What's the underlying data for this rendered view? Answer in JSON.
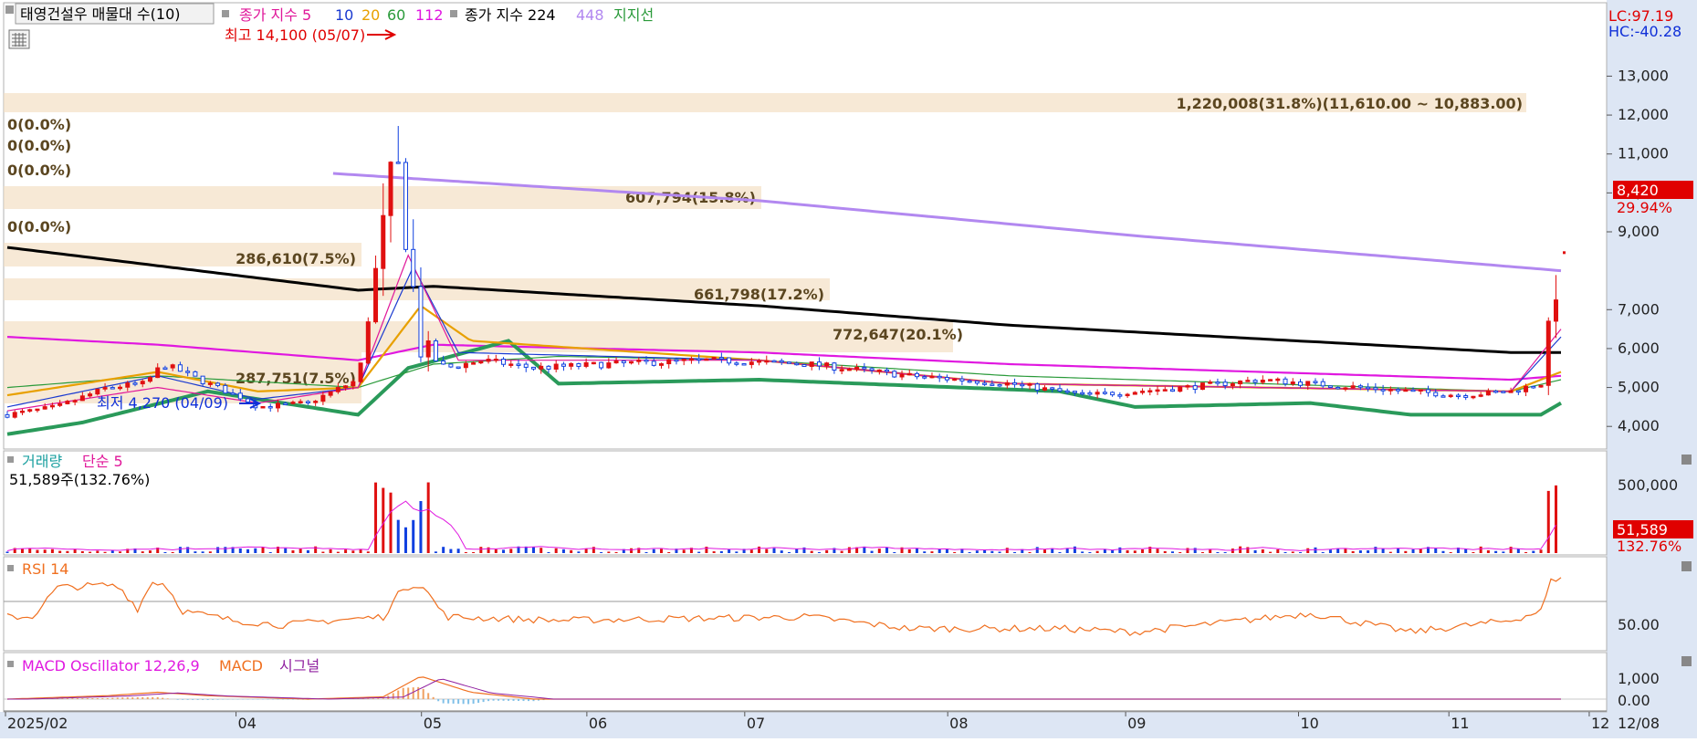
{
  "price_panel": {
    "title": "태영건설우 매물대 수(10)",
    "legend": [
      {
        "text": "종가 지수 5",
        "color": "#e0189a"
      },
      {
        "text": "10",
        "color": "#1a3ad0"
      },
      {
        "text": "20",
        "color": "#e8a000"
      },
      {
        "text": "60",
        "color": "#2a9a3a"
      },
      {
        "text": "112",
        "color": "#e018e0"
      },
      {
        "text": "종가 지수 224",
        "color": "#000000"
      },
      {
        "text": "448",
        "color": "#b288f0"
      },
      {
        "text": "지지선",
        "color": "#2a9a3a"
      }
    ],
    "high_label": "최고 14,100 (05/07)",
    "low_label": "최저 4,270 (04/09)",
    "lc": "LC:97.19",
    "hc": "HC:-40.28",
    "current_price": "8,420",
    "current_pct": "29.94%",
    "volume_profile": [
      {
        "text": "1,220,008(31.8%)(11,610.00 ~ 10,883.00)"
      },
      {
        "text": "0(0.0%)"
      },
      {
        "text": "0(0.0%)"
      },
      {
        "text": "0(0.0%)"
      },
      {
        "text": "607,794(15.8%)"
      },
      {
        "text": "0(0.0%)"
      },
      {
        "text": "286,610(7.5%)"
      },
      {
        "text": "661,798(17.2%)"
      },
      {
        "text": "772,647(20.1%)"
      },
      {
        "text": "287,751(7.5%)"
      }
    ],
    "y_ticks": [
      "13,000",
      "12,000",
      "11,000",
      "10,000",
      "9,000",
      "7,000",
      "6,000",
      "5,000",
      "4,000"
    ]
  },
  "volume_panel": {
    "legend_main": "거래량",
    "legend_ma": "단순 5",
    "value": "51,589주(132.76%)",
    "tick": "500,000",
    "badge_value": "51,589",
    "badge_pct": "132.76%"
  },
  "rsi_panel": {
    "label": "RSI 14",
    "tick": "50.00"
  },
  "macd_panel": {
    "label_osc": "MACD Oscillator 12,26,9",
    "label_macd": "MACD",
    "label_signal": "시그널",
    "ticks": [
      "1,000",
      "0.00"
    ]
  },
  "x_axis": {
    "labels": [
      "2025/02",
      "04",
      "05",
      "06",
      "07",
      "08",
      "09",
      "10",
      "11",
      "12"
    ],
    "end_label": "12/08"
  },
  "chart_data": {
    "type": "candlestick",
    "price_range": [
      3700,
      14300
    ],
    "events": [
      {
        "date": "05/07",
        "price": 14100,
        "type": "high"
      },
      {
        "date": "04/09",
        "price": 4270,
        "type": "low"
      }
    ],
    "price_waypoints": [
      [
        0,
        4300
      ],
      [
        20,
        4500
      ],
      [
        40,
        5000
      ],
      [
        55,
        5100
      ],
      [
        62,
        5600
      ],
      [
        70,
        5400
      ],
      [
        80,
        5100
      ],
      [
        95,
        4700
      ],
      [
        100,
        4500
      ],
      [
        120,
        4600
      ],
      [
        140,
        5200
      ],
      [
        155,
        11000
      ],
      [
        165,
        6000
      ],
      [
        175,
        5500
      ],
      [
        190,
        5700
      ],
      [
        210,
        5500
      ],
      [
        240,
        5600
      ],
      [
        280,
        5700
      ],
      [
        320,
        5600
      ],
      [
        360,
        5300
      ],
      [
        400,
        5100
      ],
      [
        430,
        4800
      ],
      [
        470,
        5000
      ],
      [
        500,
        5200
      ],
      [
        540,
        5000
      ],
      [
        580,
        4800
      ],
      [
        600,
        4900
      ],
      [
        612,
        5100
      ],
      [
        620,
        8420
      ]
    ],
    "ma_waypoints": {
      "ma5": [
        [
          0,
          4400
        ],
        [
          60,
          5000
        ],
        [
          100,
          4600
        ],
        [
          140,
          5000
        ],
        [
          160,
          8400
        ],
        [
          180,
          5700
        ],
        [
          300,
          5700
        ],
        [
          400,
          5100
        ],
        [
          600,
          4900
        ],
        [
          620,
          6500
        ]
      ],
      "ma10": [
        [
          0,
          4500
        ],
        [
          60,
          5300
        ],
        [
          100,
          4700
        ],
        [
          140,
          5000
        ],
        [
          162,
          8100
        ],
        [
          180,
          5900
        ],
        [
          300,
          5700
        ],
        [
          400,
          5100
        ],
        [
          600,
          4900
        ],
        [
          620,
          6300
        ]
      ],
      "ma20": [
        [
          0,
          4800
        ],
        [
          60,
          5400
        ],
        [
          100,
          4900
        ],
        [
          140,
          5000
        ],
        [
          165,
          7100
        ],
        [
          185,
          6200
        ],
        [
          300,
          5700
        ],
        [
          400,
          5100
        ],
        [
          600,
          4900
        ],
        [
          620,
          5400
        ]
      ],
      "ma60": [
        [
          0,
          5000
        ],
        [
          60,
          5300
        ],
        [
          140,
          5000
        ],
        [
          170,
          5600
        ],
        [
          220,
          5800
        ],
        [
          300,
          5700
        ],
        [
          400,
          5300
        ],
        [
          600,
          4900
        ],
        [
          620,
          5200
        ]
      ],
      "ma112": [
        [
          0,
          6300
        ],
        [
          60,
          6100
        ],
        [
          140,
          5700
        ],
        [
          170,
          6100
        ],
        [
          300,
          5900
        ],
        [
          400,
          5600
        ],
        [
          600,
          5200
        ],
        [
          620,
          5300
        ]
      ],
      "ma224": [
        [
          0,
          8600
        ],
        [
          140,
          7500
        ],
        [
          170,
          7600
        ],
        [
          300,
          7100
        ],
        [
          400,
          6600
        ],
        [
          600,
          5900
        ],
        [
          620,
          5900
        ]
      ],
      "ma448": [
        [
          130,
          10500
        ],
        [
          300,
          9800
        ],
        [
          450,
          8900
        ],
        [
          620,
          8000
        ]
      ],
      "support": [
        [
          0,
          3800
        ],
        [
          30,
          4100
        ],
        [
          80,
          4900
        ],
        [
          140,
          4300
        ],
        [
          160,
          5500
        ],
        [
          200,
          6200
        ],
        [
          220,
          5100
        ],
        [
          300,
          5200
        ],
        [
          420,
          4900
        ],
        [
          450,
          4500
        ],
        [
          520,
          4600
        ],
        [
          560,
          4300
        ],
        [
          612,
          4300
        ],
        [
          620,
          4600
        ]
      ]
    }
  }
}
